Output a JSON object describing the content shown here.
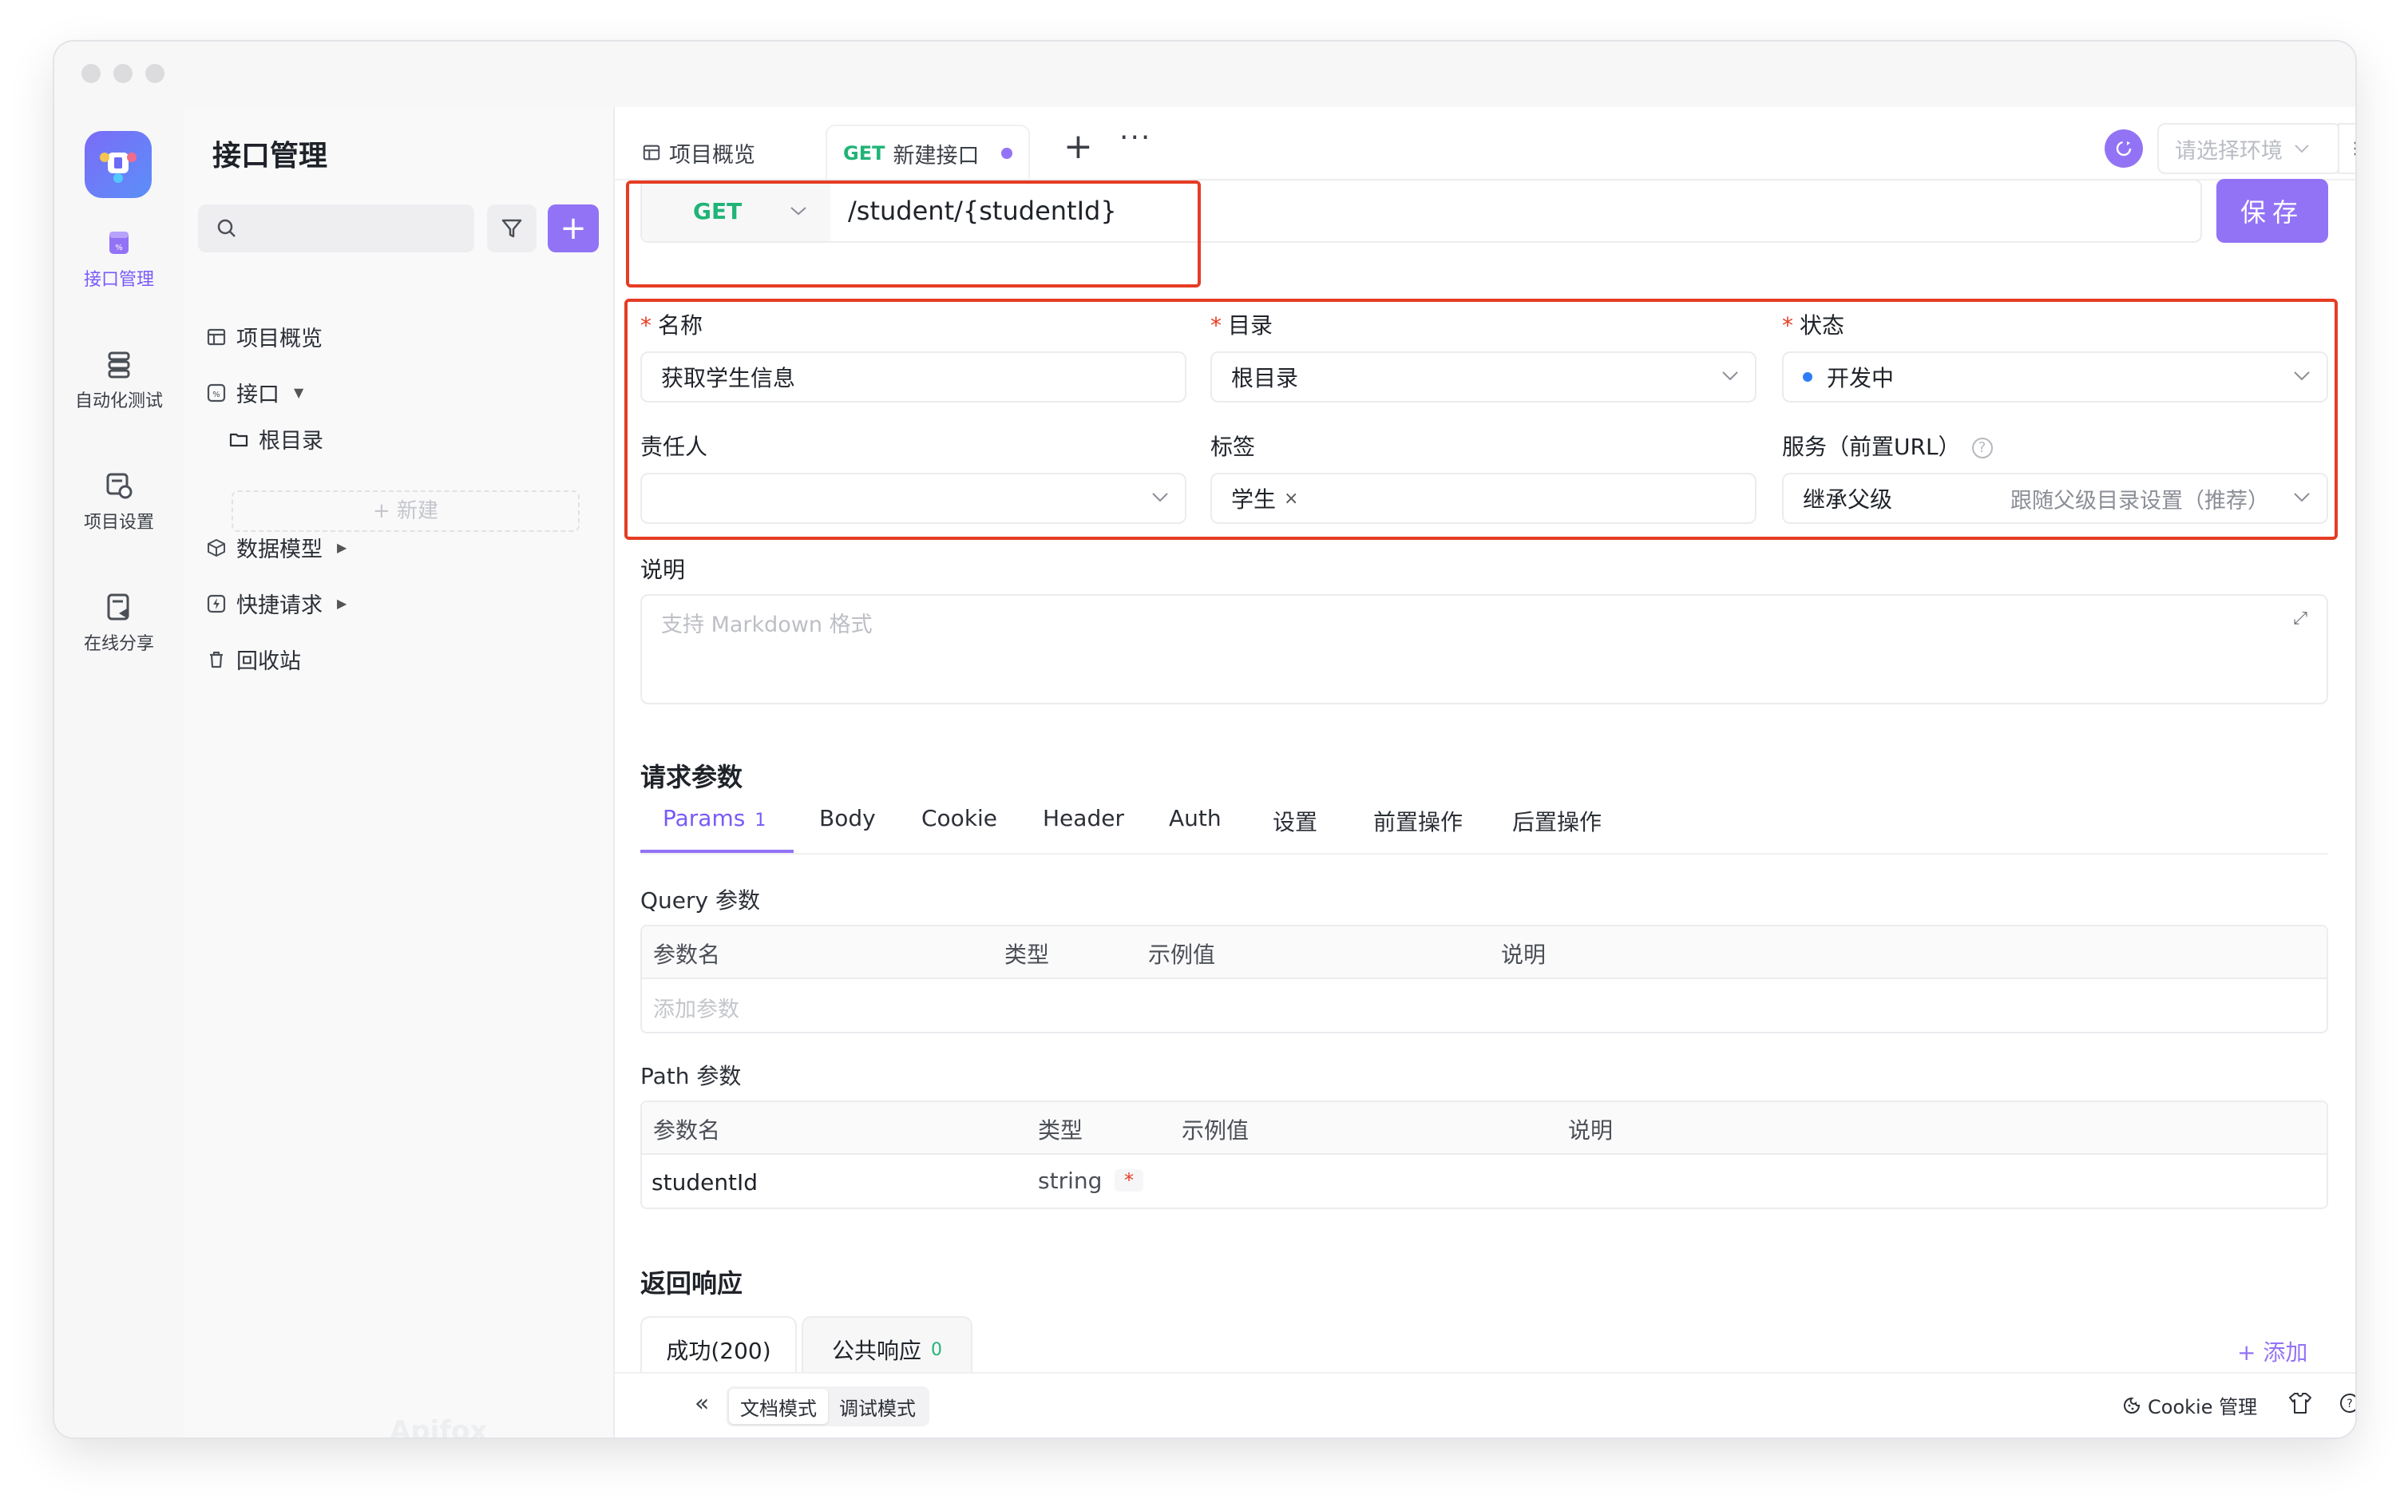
{
  "sidebar": {
    "title": "接口管理",
    "search_placeholder": "",
    "tree": {
      "overview": "项目概览",
      "interfaces": "接口",
      "root": "根目录",
      "new": "+ 新建",
      "models": "数据模型",
      "quick": "快捷请求",
      "trash": "回收站"
    },
    "watermark": "Apifox"
  },
  "rail": {
    "api": "接口管理",
    "auto": "自动化测试",
    "settings": "项目设置",
    "share": "在线分享"
  },
  "tabs": {
    "overview": "项目概览",
    "method": "GET",
    "new_api": "新建接口"
  },
  "env": {
    "placeholder": "请选择环境"
  },
  "request": {
    "method": "GET",
    "url": "/student/{studentId}",
    "save": "保存"
  },
  "form": {
    "name_label": "名称",
    "name_value": "获取学生信息",
    "dir_label": "目录",
    "dir_value": "根目录",
    "status_label": "状态",
    "status_value": "开发中",
    "owner_label": "责任人",
    "tag_label": "标签",
    "tag_value": "学生",
    "service_label": "服务（前置URL）",
    "service_value": "继承父级",
    "service_hint": "跟随父级目录设置（推荐）",
    "desc_label": "说明",
    "desc_placeholder": "支持 Markdown 格式"
  },
  "params": {
    "section": "请求参数",
    "tabs": [
      "Params",
      "Body",
      "Cookie",
      "Header",
      "Auth",
      "设置",
      "前置操作",
      "后置操作"
    ],
    "params_count": "1",
    "query_title": "Query 参数",
    "path_title": "Path 参数",
    "col_name": "参数名",
    "col_type": "类型",
    "col_example": "示例值",
    "col_desc": "说明",
    "add_param": "添加参数",
    "path_row": {
      "name": "studentId",
      "type": "string",
      "required": "*"
    }
  },
  "response": {
    "section": "返回响应",
    "success_tab": "成功(200)",
    "common_tab": "公共响应",
    "common_count": "0",
    "add": "+ 添加"
  },
  "bottom": {
    "doc_mode": "文档模式",
    "debug_mode": "调试模式",
    "cookie": "Cookie 管理"
  },
  "colors": {
    "accent": "#9373f5",
    "get": "#20b477",
    "highlight": "#e53d24"
  }
}
